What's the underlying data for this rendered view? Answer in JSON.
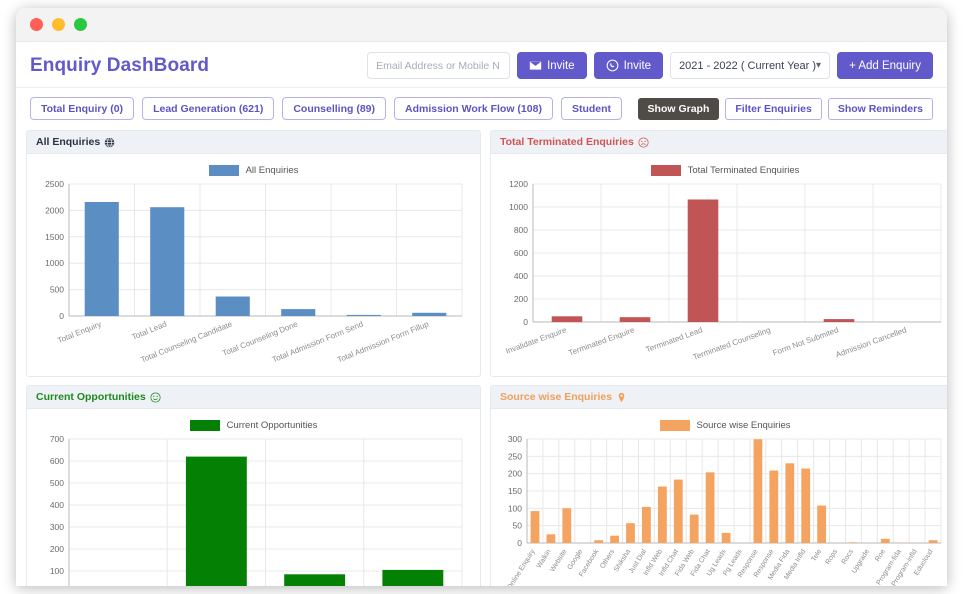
{
  "window": {
    "dots": [
      "close",
      "minimize",
      "maximize"
    ]
  },
  "header": {
    "title": "Enquiry DashBoard",
    "invite_input_placeholder": "Email Address or Mobile N",
    "invite_input_value": "",
    "email_invite_label": "Invite",
    "whatsapp_invite_label": "Invite",
    "year_selected": "2021 - 2022 ( Current Year )",
    "add_enquiry_label": "+ Add Enquiry",
    "accent_purple": "#6259ca"
  },
  "tabs": [
    {
      "label": "Total Enquiry (0)",
      "active": false
    },
    {
      "label": "Lead Generation (621)",
      "active": false
    },
    {
      "label": "Counselling (89)",
      "active": false
    },
    {
      "label": "Admission Work Flow (108)",
      "active": false
    },
    {
      "label": "Student",
      "active": false
    }
  ],
  "actions": [
    {
      "label": "Show Graph",
      "active": true
    },
    {
      "label": "Filter Enquiries",
      "active": false
    },
    {
      "label": "Show Reminders",
      "active": false
    }
  ],
  "cards": [
    {
      "title": "All Enquiries",
      "icon": "globe-icon",
      "color": "#2c3143"
    },
    {
      "title": "Total Terminated Enquiries",
      "icon": "sad-face-icon",
      "color": "#d05454"
    },
    {
      "title": "Current Opportunities",
      "icon": "smiley-face-icon",
      "color": "#1e8a1e"
    },
    {
      "title": "Source wise Enquiries",
      "icon": "map-pin-icon",
      "color": "#f0a05a"
    }
  ],
  "chart_data": [
    {
      "type": "bar",
      "title": "All Enquiries",
      "legend": [
        "All Enquiries"
      ],
      "color": "#5b8fc4",
      "categories": [
        "Total Enquiry",
        "Total Lead",
        "Total Counseling Candidate",
        "Total Counseling Done",
        "Total Admission Form Send",
        "Total Admission Form Fillup"
      ],
      "values": [
        2160,
        2060,
        370,
        130,
        20,
        60
      ],
      "yticks": [
        0,
        500,
        1000,
        1500,
        2000,
        2500
      ],
      "ylim": [
        0,
        2500
      ],
      "xlabel": "",
      "ylabel": "",
      "grid": true,
      "legend_position": "top-center"
    },
    {
      "type": "bar",
      "title": "Total Terminated Enquiries",
      "legend": [
        "Total Terminated Enquiries"
      ],
      "color": "#c15454",
      "categories": [
        "Invalidate Enquire",
        "Terminated Enquire",
        "Terminated Lead",
        "Terminated Counseling",
        "Form Not Submited",
        "Admission Cancelled"
      ],
      "values": [
        50,
        42,
        1065,
        0,
        25,
        0
      ],
      "yticks": [
        0,
        200,
        400,
        600,
        800,
        1000,
        1200
      ],
      "ylim": [
        0,
        1200
      ],
      "xlabel": "",
      "ylabel": "",
      "grid": true,
      "legend_position": "top-center"
    },
    {
      "type": "bar",
      "title": "Current Opportunities",
      "legend": [
        "Current Opportunities"
      ],
      "color": "#048004",
      "categories": [
        "",
        "",
        "",
        ""
      ],
      "values": [
        0,
        620,
        85,
        105
      ],
      "yticks": [
        100,
        200,
        300,
        400,
        500,
        600,
        700
      ],
      "ylim": [
        0,
        700
      ],
      "xlabel": "",
      "ylabel": "",
      "grid": true,
      "legend_position": "top-center"
    },
    {
      "type": "bar",
      "title": "Source wise Enquiries",
      "legend": [
        "Source wise Enquiries"
      ],
      "color": "#f4a460",
      "categories": [
        "Online Enquiry",
        "Walkin",
        "Website",
        "Google",
        "Facebook",
        "Others",
        "Shiksha",
        "Just Dial",
        "Infld Web",
        "Infld Chat",
        "Fida Web",
        "Fida Chat",
        "Ug Leads",
        "Pg Leads",
        "Response",
        "Response",
        "Media Fida",
        "Media Infld",
        "Tele",
        "Rops",
        "Rocs",
        "Upgrade",
        "Roe",
        "Program-fida",
        "Program-infld",
        "Educloud"
      ],
      "values": [
        92,
        25,
        100,
        0,
        8,
        21,
        57,
        104,
        163,
        183,
        82,
        204,
        29,
        0,
        299,
        209,
        230,
        215,
        108,
        0,
        2,
        0,
        12,
        1,
        0,
        8
      ],
      "yticks": [
        0,
        50,
        100,
        150,
        200,
        250,
        300
      ],
      "ylim": [
        0,
        300
      ],
      "xlabel": "",
      "ylabel": "",
      "grid": true,
      "legend_position": "top-center"
    }
  ]
}
